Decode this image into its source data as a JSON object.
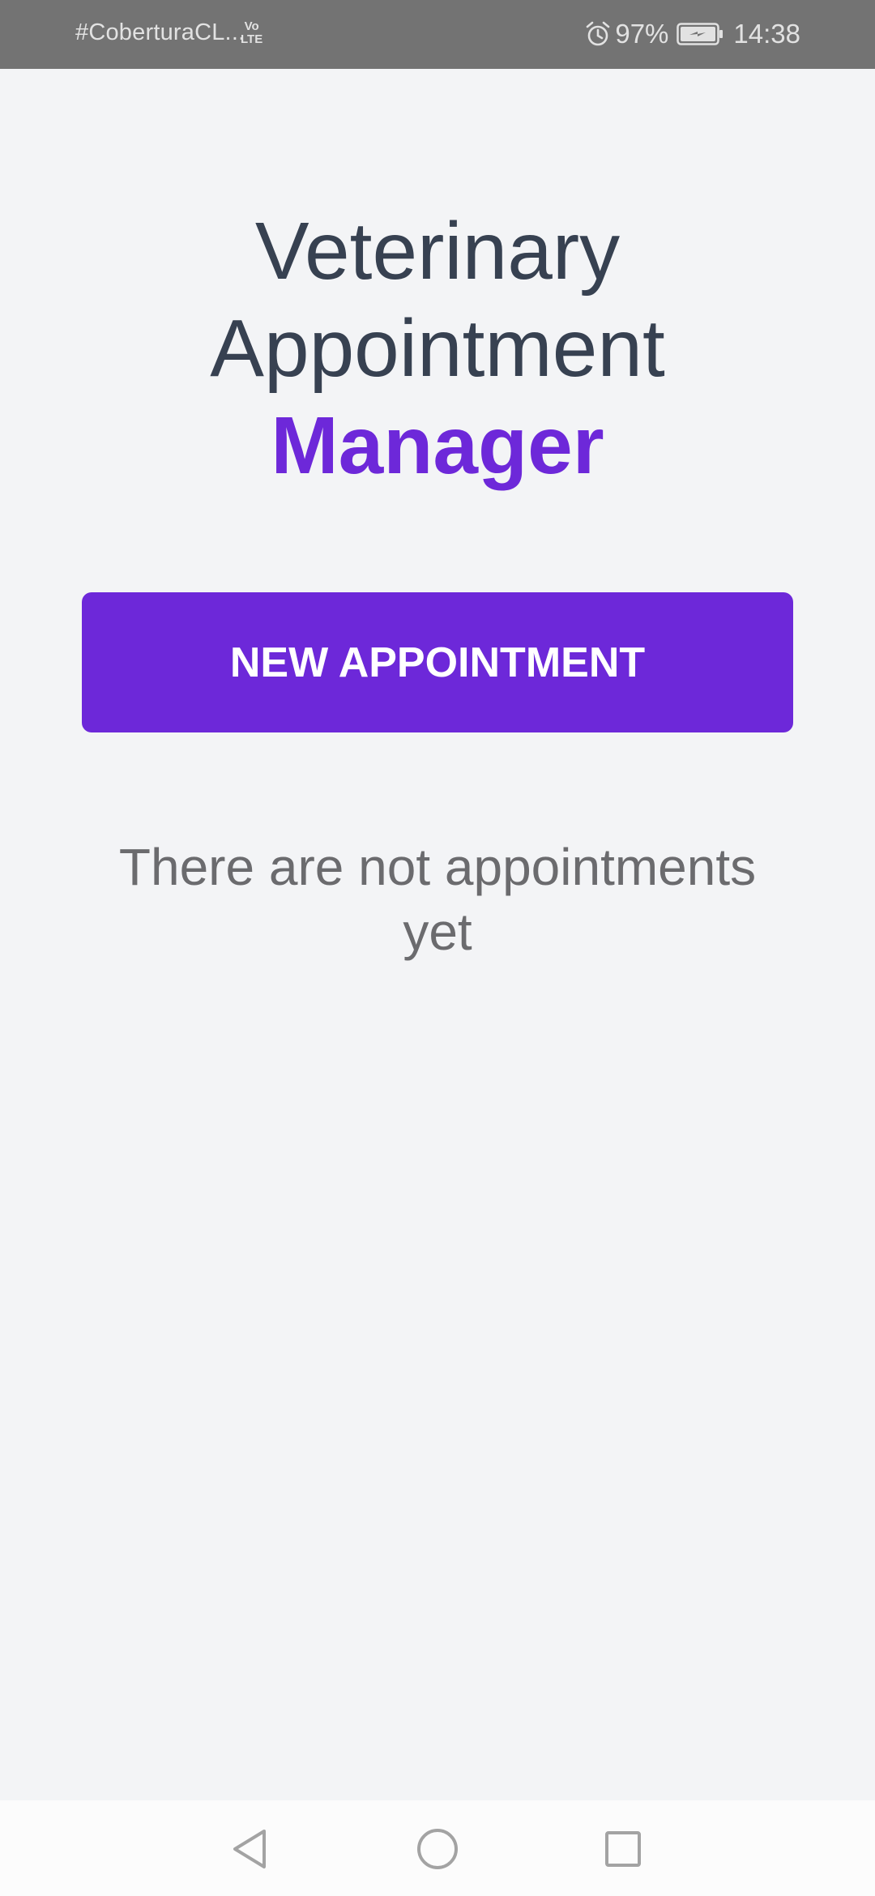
{
  "status_bar": {
    "carrier": "#CoberturaCL...",
    "network_top": "Vo",
    "network_bottom": "LTE",
    "battery": "97%",
    "time": "14:38",
    "icons": [
      "alarm-icon",
      "battery-charging-icon"
    ]
  },
  "header": {
    "title_line1": "Veterinary",
    "title_line2": "Appointment",
    "title_accent": "Manager"
  },
  "actions": {
    "new_appointment_label": "NEW APPOINTMENT"
  },
  "appointments": {
    "empty_message": "There are not appointments yet"
  },
  "nav_bar": {
    "icons": [
      "back-icon",
      "home-icon",
      "recents-icon"
    ]
  },
  "colors": {
    "accent": "#6D28D9",
    "title": "#374151",
    "background": "#F3F4F6",
    "status_bar": "#737373",
    "muted_text": "#6B6B6E"
  }
}
